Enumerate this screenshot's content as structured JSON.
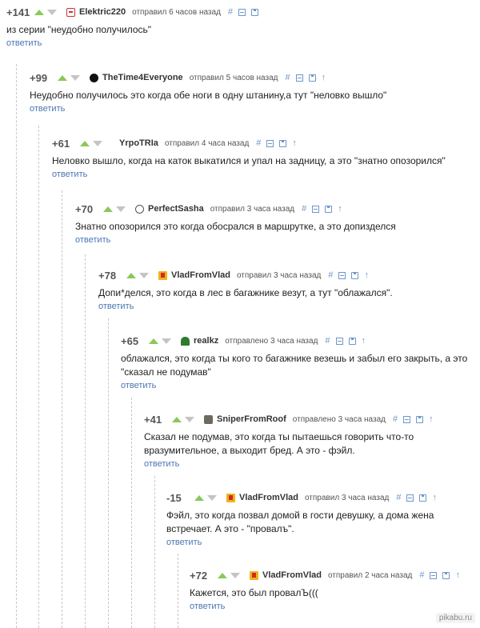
{
  "comments": [
    {
      "rating": "+141",
      "user": "Elektric220",
      "meta": "отправил 6 часов назад",
      "text": "из серии \"неудобно получилось\"",
      "reply": "ответить"
    },
    {
      "rating": "+99",
      "user": "TheTime4Everyone",
      "meta": "отправил 5 часов назад",
      "text": "Неудобно получилось это когда обе ноги в одну штанину,а тут \"неловко вышло\"",
      "reply": "ответить"
    },
    {
      "rating": "+61",
      "user": "YrpoTRIa",
      "meta": "отправил 4 часа назад",
      "text": "Неловко вышло, когда на каток выкатился и упал на задницу, а это \"знатно опозорился\"",
      "reply": "ответить"
    },
    {
      "rating": "+70",
      "user": "PerfectSasha",
      "meta": "отправил 3 часа назад",
      "text": "Знатно опозорился это когда обосрался в маршрутке, а это допизделся",
      "reply": "ответить"
    },
    {
      "rating": "+78",
      "user": "VladFromVlad",
      "meta": "отправил 3 часа назад",
      "text": "Допи*делся, это когда в лес в багажнике везут, а тут \"облажался\".",
      "reply": "ответить"
    },
    {
      "rating": "+65",
      "user": "realkz",
      "meta": "отправлено 3 часа назад",
      "text": "облажался, это когда ты кого то багажнике везешь и забыл его закрыть, а это \"сказал не подумав\"",
      "reply": "ответить"
    },
    {
      "rating": "+41",
      "user": "SniperFromRoof",
      "meta": "отправлено 3 часа назад",
      "text": "Сказал не подумав, это когда ты пытаешься говорить что-то вразумительное, а выходит бред. А это - фэйл.",
      "reply": "ответить"
    },
    {
      "rating": "-15",
      "user": "VladFromVlad",
      "meta": "отправил 3 часа назад",
      "text": "Фэйл, это когда позвал домой в гости девушку, а дома жена встречает. А это - \"провалъ\".",
      "reply": "ответить"
    },
    {
      "rating": "+72",
      "user": "VladFromVlad",
      "meta": "отправил 2 часа назад",
      "text": "Кажется, это был провалЪ(((",
      "reply": "ответить"
    }
  ],
  "tools": {
    "hash": "#",
    "up": "↑"
  },
  "watermark": "pikabu.ru",
  "colors": {
    "vote_up": "#8ac858",
    "vote_down": "#c4c4c4",
    "link": "#4b76b3",
    "tool": "#6f97c8"
  }
}
